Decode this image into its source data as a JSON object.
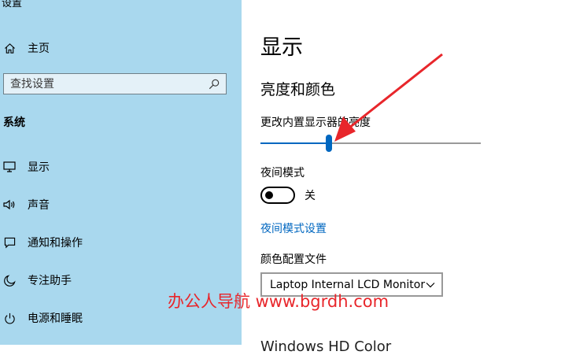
{
  "app": {
    "title": "设置"
  },
  "sidebar": {
    "home_label": "主页",
    "search_placeholder": "查找设置",
    "section_label": "系统",
    "items": [
      {
        "label": "显示",
        "icon": "monitor-icon"
      },
      {
        "label": "声音",
        "icon": "speaker-icon"
      },
      {
        "label": "通知和操作",
        "icon": "notification-icon"
      },
      {
        "label": "专注助手",
        "icon": "moon-icon"
      },
      {
        "label": "电源和睡眠",
        "icon": "power-icon"
      }
    ]
  },
  "main": {
    "page_title": "显示",
    "subhead": "亮度和颜色",
    "brightness": {
      "label": "更改内置显示器的亮度",
      "value_percent": 31
    },
    "night_mode": {
      "label": "夜间模式",
      "state_text": "关",
      "on": false
    },
    "night_settings_link": "夜间模式设置",
    "color_profile": {
      "label": "颜色配置文件",
      "selected": "Laptop Internal LCD Monitor"
    },
    "cutoff_text": "Windows HD Color"
  },
  "watermark": {
    "text": "办公人导航 www.bgrdh.com"
  },
  "colors": {
    "sidebar_bg": "#a9d8ee",
    "accent": "#0067c0",
    "arrow": "#e8262b"
  }
}
